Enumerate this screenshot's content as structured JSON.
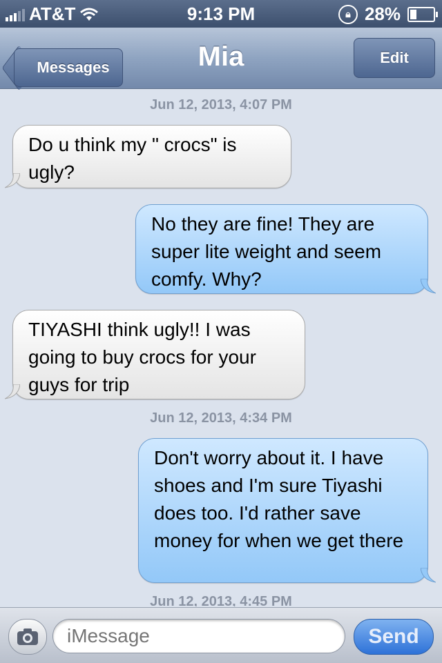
{
  "status_bar": {
    "carrier": "AT&T",
    "time": "9:13 PM",
    "battery": "28%",
    "battery_level": 0.28,
    "icons": [
      "signal-bars-icon",
      "wifi-icon",
      "rotation-lock-icon",
      "battery-icon"
    ]
  },
  "nav": {
    "back_label": "Messages",
    "title": "Mia",
    "edit_label": "Edit"
  },
  "conversation": {
    "timestamps": [
      "Jun 12, 2013, 4:07 PM",
      "Jun 12, 2013, 4:34 PM",
      "Jun 12, 2013, 4:45 PM"
    ],
    "messages": [
      {
        "from": "received",
        "text": "Do u think my \" crocs\" is ugly?"
      },
      {
        "from": "sent",
        "text": "No they are fine! They are super lite weight and seem comfy. Why?"
      },
      {
        "from": "received",
        "text": "TIYASHI think ugly!!  I was going to buy crocs for your guys for trip"
      },
      {
        "from": "sent",
        "text": "Don't worry about it. I have shoes and I'm sure Tiyashi does too. I'd rather save money for when we get there"
      }
    ]
  },
  "input_bar": {
    "placeholder": "iMessage",
    "send_label": "Send",
    "camera_icon": "camera-icon"
  },
  "colors": {
    "sent_bubble": "#93c8f8",
    "received_bubble": "#e4e4e4",
    "nav_bar": "#8fa4c1",
    "send_button": "#2e72d8"
  }
}
